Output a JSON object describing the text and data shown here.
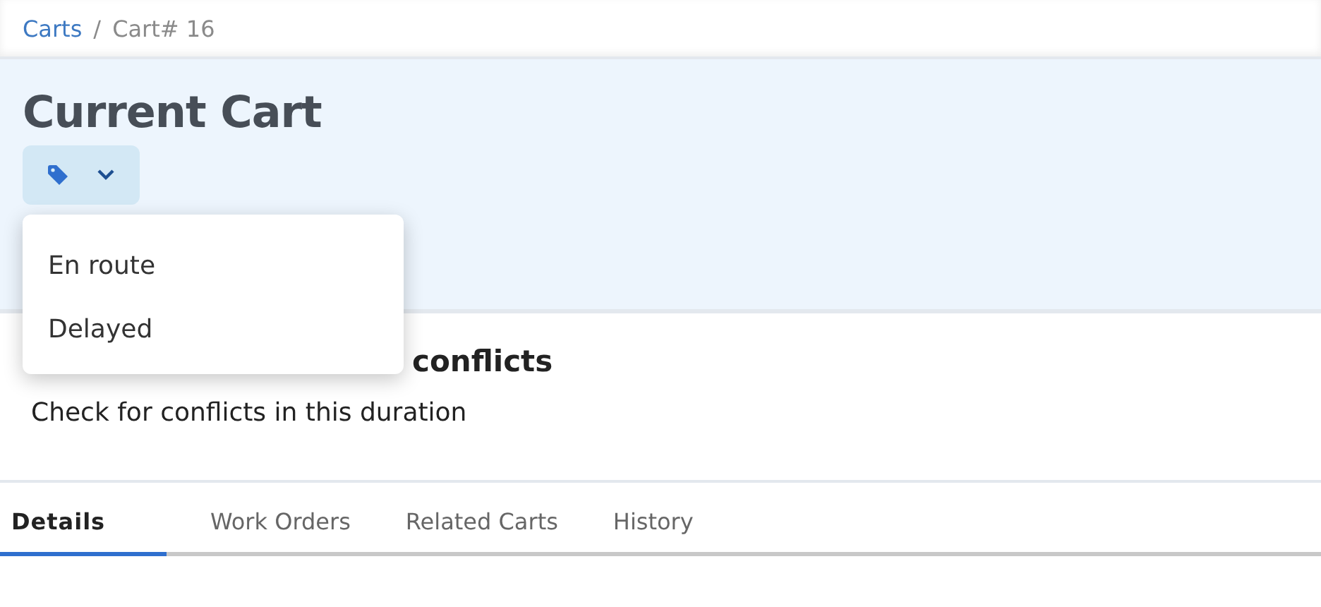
{
  "breadcrumb_separator": "/",
  "breadcrumb": [
    {
      "label": "Carts",
      "kind": "link"
    },
    {
      "label": "Cart# 16",
      "kind": "current"
    }
  ],
  "header": {
    "title": "Current Cart"
  },
  "tag_menu": {
    "expanded": true,
    "items": [
      "En route",
      "Delayed"
    ]
  },
  "section": {
    "heading": "conflicts",
    "description": "Check for conflicts in this duration"
  },
  "tabs": [
    {
      "label": "Details",
      "selected": true
    },
    {
      "label": "Work Orders",
      "selected": false
    },
    {
      "label": "Related Carts",
      "selected": false
    },
    {
      "label": "History",
      "selected": false
    }
  ]
}
